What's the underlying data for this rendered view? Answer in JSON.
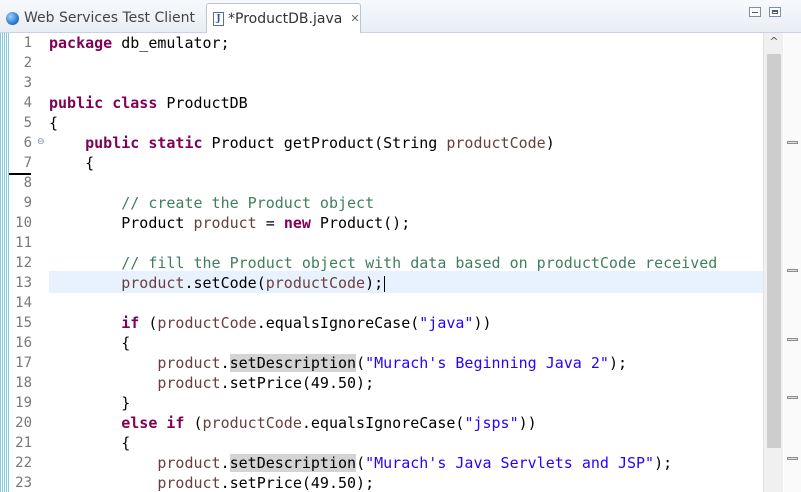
{
  "tabs": [
    {
      "label": "Web Services Test Client",
      "icon": "globe-icon",
      "active": false
    },
    {
      "label": "*ProductDB.java",
      "icon": "java-file-icon",
      "active": true,
      "close": "✕"
    }
  ],
  "editor": {
    "line_numbers": [
      "1",
      "2",
      "3",
      "4",
      "5",
      "6",
      "7",
      "8",
      "9",
      "10",
      "11",
      "12",
      "13",
      "14",
      "15",
      "16",
      "17",
      "18",
      "19",
      "20",
      "21",
      "22",
      "23"
    ],
    "current_line": 13
  },
  "code": {
    "l1_kw": "package",
    "l1_rest": " db_emulator;",
    "l4_kw": "public class",
    "l4_rest": " ProductDB",
    "l5": "{",
    "l6_kw": "public static",
    "l6_mid": " Product getProduct(String ",
    "l6_var": "productCode",
    "l6_end": ")",
    "l7": "{",
    "l9_cm": "// create the Product object",
    "l10_a": "Product ",
    "l10_var": "product",
    "l10_b": " = ",
    "l10_kw": "new",
    "l10_c": " Product();",
    "l12_cm": "// fill the Product object with data based on productCode received",
    "l13_var1": "product",
    "l13_a": ".setCode(",
    "l13_var2": "productCode",
    "l13_b": ");",
    "l15_kw": "if",
    "l15_a": " (",
    "l15_var": "productCode",
    "l15_b": ".equalsIgnoreCase(",
    "l15_str": "\"java\"",
    "l15_c": "))",
    "l16": "{",
    "l17_var": "product",
    "l17_a": ".",
    "l17_hl": "setDescription",
    "l17_b": "(",
    "l17_str": "\"Murach's Beginning Java 2\"",
    "l17_c": ");",
    "l18_var": "product",
    "l18_a": ".setPrice(49.50);",
    "l19": "}",
    "l20_kw": "else if",
    "l20_a": " (",
    "l20_var": "productCode",
    "l20_b": ".equalsIgnoreCase(",
    "l20_str": "\"jsps\"",
    "l20_c": "))",
    "l21": "{",
    "l22_var": "product",
    "l22_a": ".",
    "l22_hl": "setDescription",
    "l22_b": "(",
    "l22_str": "\"Murach's Java Servlets and JSP\"",
    "l22_c": ");",
    "l23_var": "product",
    "l23_a": ".setPrice(49.50);"
  },
  "colors": {
    "keyword": "#7f0055",
    "comment": "#3f7f5f",
    "string": "#2a00ff",
    "variable": "#6a3e3e",
    "current_line": "#e8f2fe",
    "occurrence_highlight": "#d4d4d4"
  }
}
